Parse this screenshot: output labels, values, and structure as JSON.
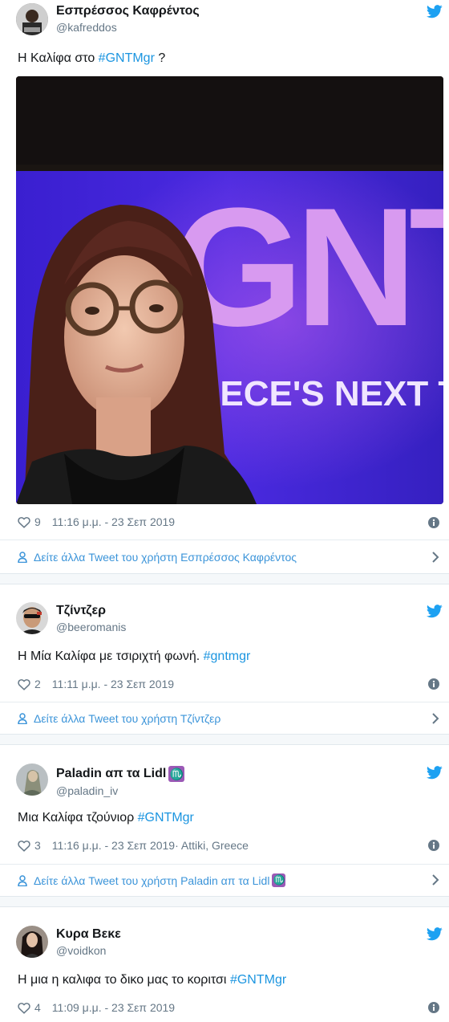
{
  "tweets": [
    {
      "name": "Εσπρέσσος Καφρέντος",
      "handle": "@kafreddos",
      "text_before": "Η Καλίφα στο ",
      "hashtag": "#GNTMgr",
      "text_after": " ?",
      "likes": "9",
      "time": "11:16 μ.μ. - 23 Σεπ 2019",
      "location": "",
      "more_link": "Δείτε άλλα Tweet του χρήστη Εσπρέσσος Καφρέντος",
      "photo_text": {
        "big": "GNT",
        "small": "EECE'S NEXT TO"
      }
    },
    {
      "name": "Τζίντζερ",
      "handle": "@beeromanis",
      "text_before": "Η Μία Καλίφα με τσιριχτή φωνή. ",
      "hashtag": "#gntmgr",
      "text_after": "",
      "likes": "2",
      "time": "11:11 μ.μ. - 23 Σεπ 2019",
      "location": "",
      "more_link": "Δείτε άλλα Tweet του χρήστη Τζίντζερ"
    },
    {
      "name": "Paladin απ τα Lidl",
      "name_emoji": "♏",
      "handle": "@paladin_iv",
      "text_before": "Μια Καλίφα τζούνιορ ",
      "hashtag": "#GNTMgr",
      "text_after": "",
      "likes": "3",
      "time": "11:16 μ.μ. - 23 Σεπ 2019",
      "location": " · Attiki, Greece",
      "more_link": "Δείτε άλλα Tweet του χρήστη Paladin απ τα Lidl"
    },
    {
      "name": "Κυρα Βεκε",
      "handle": "@voidkon",
      "text_before": "Η μια η καλιφα το δικο μας το κοριτσι ",
      "hashtag": "#GNTMgr",
      "text_after": "",
      "likes": "4",
      "time": "11:09 μ.μ. - 23 Σεπ 2019",
      "location": ""
    }
  ],
  "icons": {
    "bird": "twitter-bird-icon",
    "heart": "heart-icon",
    "info": "info-icon",
    "person": "person-icon",
    "chevron": "chevron-right-icon",
    "zodiac": "scorpius-emoji"
  },
  "colors": {
    "link": "#1b95e0",
    "more_link": "#3b94d9",
    "muted": "#657786",
    "bird": "#1da1f2"
  }
}
